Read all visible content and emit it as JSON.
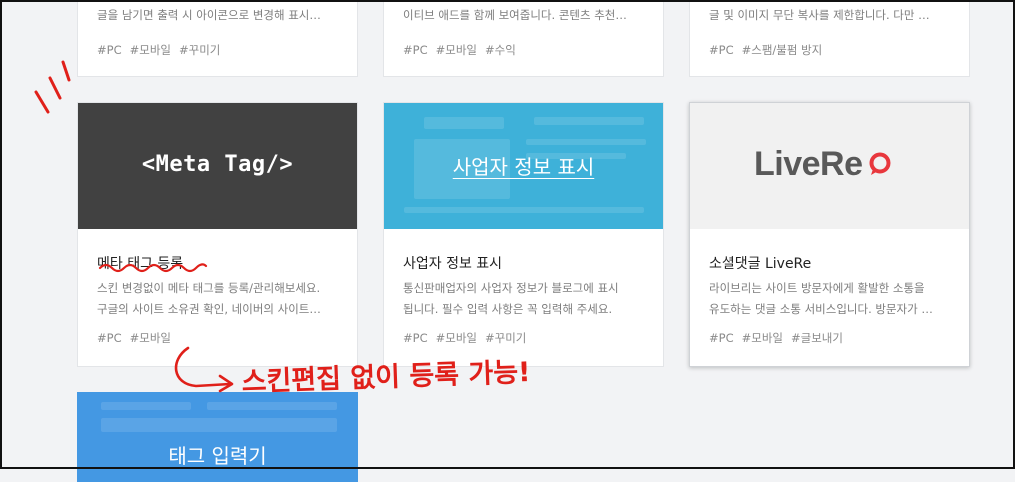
{
  "top_row": [
    {
      "desc_line2": "글을 남기면 출력 시 아이콘으로 변경해 표시…",
      "tags": [
        "#PC",
        "#모바일",
        "#꾸미기"
      ]
    },
    {
      "desc_line2": "이티브 애드를 함께 보여줍니다. 콘텐츠 추천…",
      "tags": [
        "#PC",
        "#모바일",
        "#수익"
      ]
    },
    {
      "desc_line2": "글 및 이미지 무단 복사를 제한합니다. 다만 …",
      "tags": [
        "#PC",
        "#스팸/불펌 방지"
      ]
    }
  ],
  "cards": [
    {
      "thumb_text": "<Meta Tag/>",
      "title": "메타 태그 등록",
      "desc": [
        "스킨 변경없이 메타 태그를 등록/관리해보세요.",
        "구글의 사이트 소유권 확인, 네이버의 사이트…"
      ],
      "tags": [
        "#PC",
        "#모바일"
      ]
    },
    {
      "thumb_text": "사업자 정보 표시",
      "title": "사업자 정보 표시",
      "desc": [
        "통신판매업자의 사업자 정보가 블로그에 표시",
        "됩니다. 필수 입력 사항은 꼭 입력해 주세요."
      ],
      "tags": [
        "#PC",
        "#모바일",
        "#꾸미기"
      ]
    },
    {
      "thumb_text": "LiveRe",
      "title": "소셜댓글 LiveRe",
      "desc": [
        "라이브리는 사이트 방문자에게 활발한 소통을",
        "유도하는 댓글 소통 서비스입니다. 방문자가 …"
      ],
      "tags": [
        "#PC",
        "#모바일",
        "#글보내기"
      ]
    },
    {
      "thumb_text": "태그 입력기"
    }
  ],
  "annotation": {
    "text": "스킨편집 없이 등록 가능!",
    "color": "#e0201a"
  },
  "colors": {
    "page_bg": "#f2f3f5",
    "meta_thumb": "#414141",
    "biz_thumb": "#3eb1d9",
    "livere_thumb": "#f1f1f1",
    "tag_thumb": "#4498e3",
    "livere_accent": "#e8373d"
  }
}
